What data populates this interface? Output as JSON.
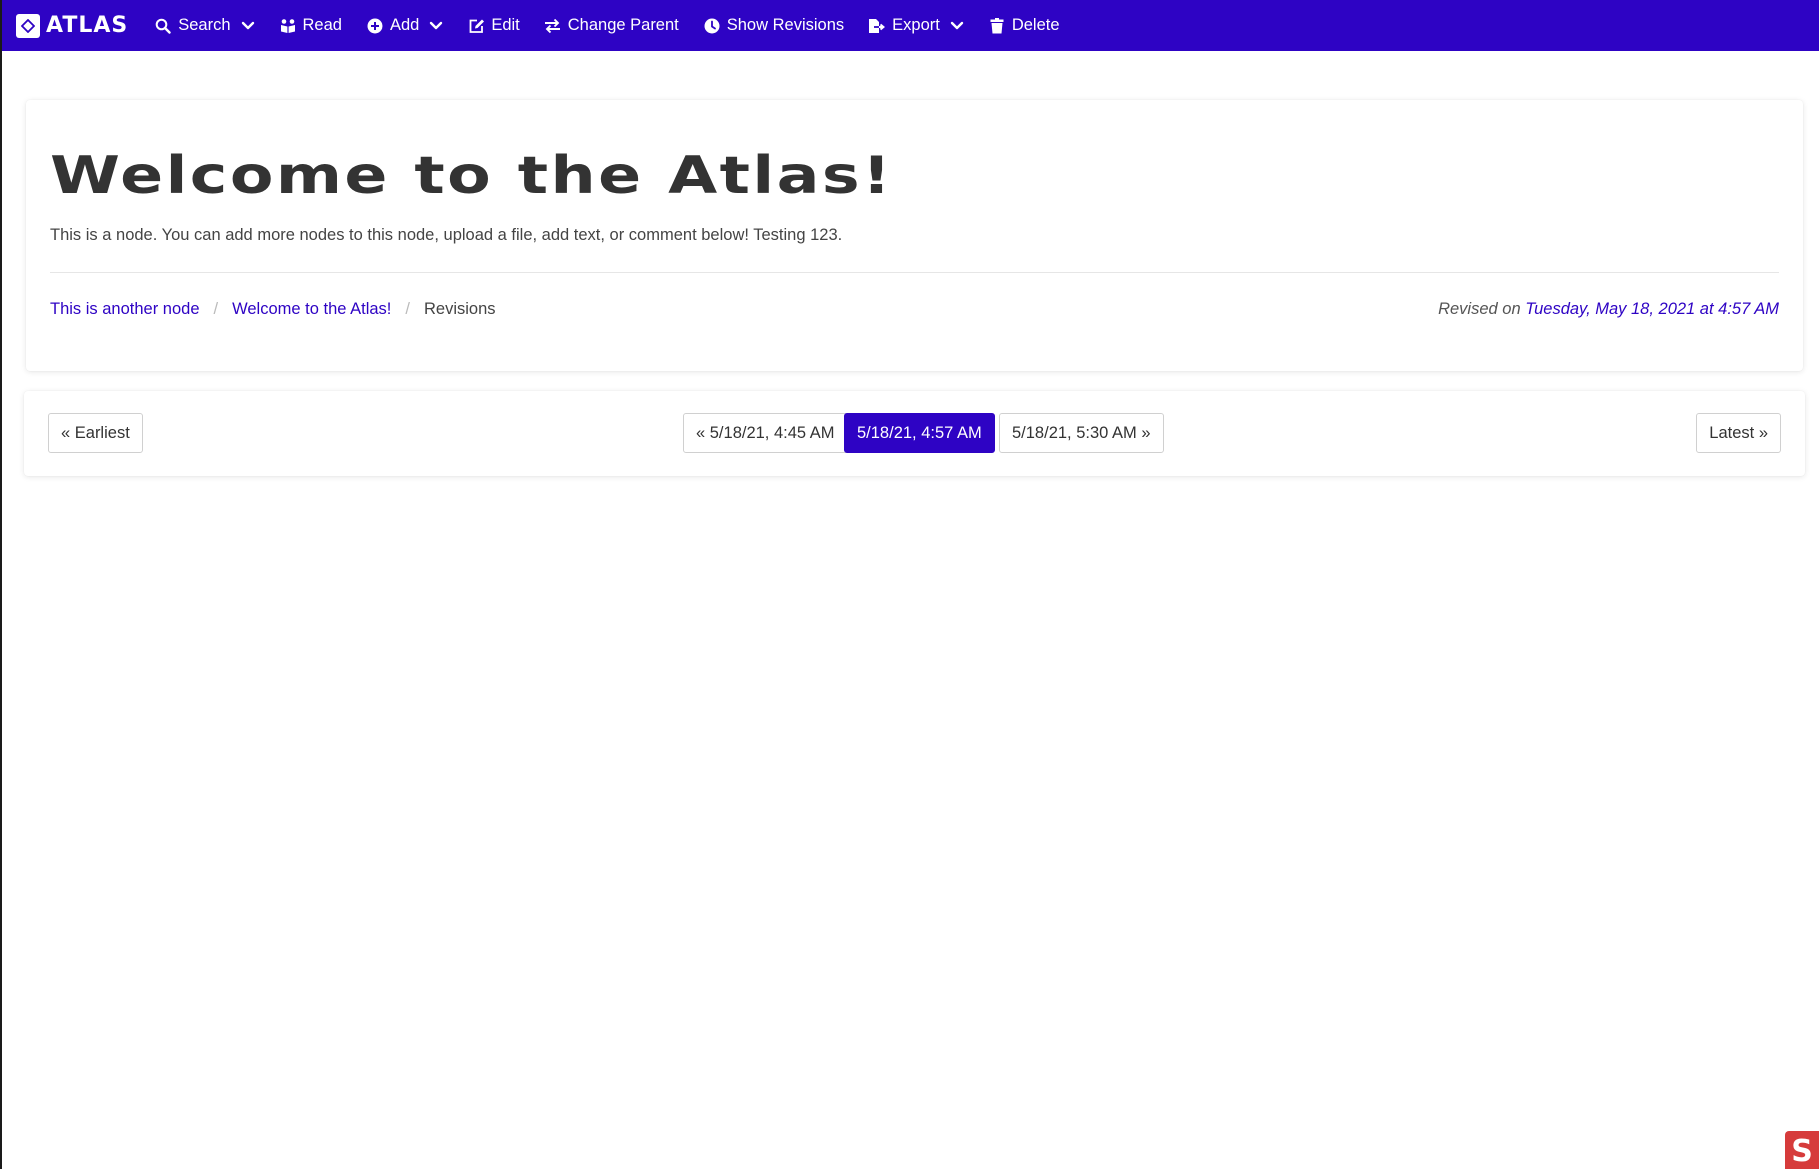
{
  "navbar": {
    "brand": "ATLAS",
    "items": [
      {
        "label": "Search",
        "icon": "search-icon",
        "dropdown": true
      },
      {
        "label": "Read",
        "icon": "read-icon",
        "dropdown": false
      },
      {
        "label": "Add",
        "icon": "plus-circle-icon",
        "dropdown": true
      },
      {
        "label": "Edit",
        "icon": "edit-icon",
        "dropdown": false
      },
      {
        "label": "Change Parent",
        "icon": "swap-icon",
        "dropdown": false
      },
      {
        "label": "Show Revisions",
        "icon": "clock-icon",
        "dropdown": false
      },
      {
        "label": "Export",
        "icon": "export-icon",
        "dropdown": true
      },
      {
        "label": "Delete",
        "icon": "trash-icon",
        "dropdown": false
      }
    ]
  },
  "node": {
    "title": "Welcome to the Atlas!",
    "description": "This is a node. You can add more nodes to this node, upload a file, add text, or comment below! Testing 123.",
    "breadcrumb": [
      "This is another node",
      "Welcome to the Atlas!",
      "Revisions"
    ],
    "revised_prefix": "Revised on",
    "revised_date": "Tuesday, May 18, 2021 at 4:57 AM"
  },
  "pager": {
    "earliest": "« Earliest",
    "previous": "« 5/18/21, 4:45 AM",
    "current": "5/18/21, 4:57 AM",
    "next": "5/18/21, 5:30 AM »",
    "latest": "Latest »"
  },
  "colors": {
    "brand": "#2e03c4",
    "badge": "#d63b3b"
  }
}
